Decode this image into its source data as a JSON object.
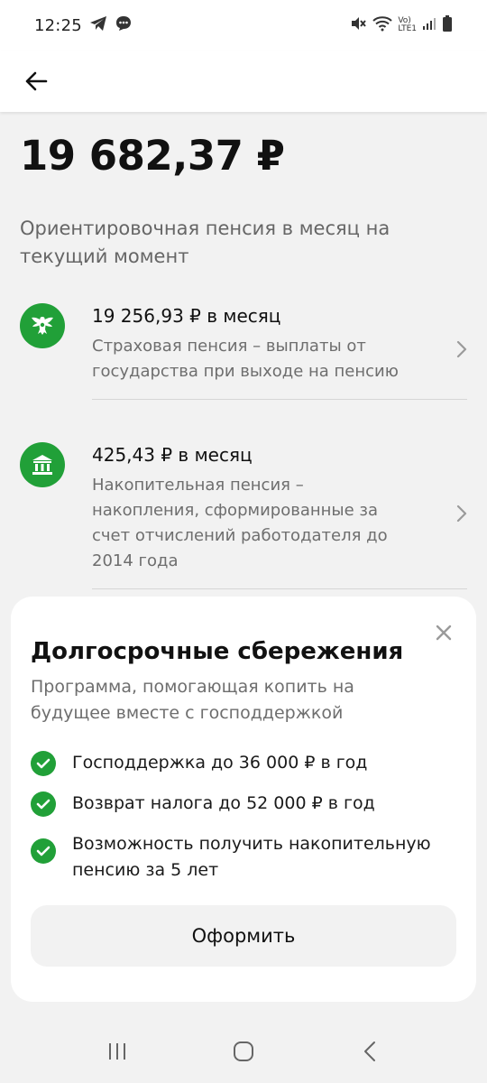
{
  "status_bar": {
    "time": "12:25",
    "network_label_top": "Vo)",
    "network_label_bottom": "LTE1"
  },
  "header": {
    "back_icon": "arrow-left-icon"
  },
  "summary": {
    "amount": "19 682,37 ₽",
    "subtitle": "Ориентировочная пенсия в месяц на текущий момент"
  },
  "pensions": [
    {
      "icon": "eagle-emblem-icon",
      "title": "19 256,93 ₽ в месяц",
      "description": "Страховая пенсия – выплаты от государства при выходе на пенсию"
    },
    {
      "icon": "bank-building-icon",
      "title": "425,43 ₽ в месяц",
      "description": "Накопительная пенсия – накопления, сформированные за счет отчислений работодателя до 2014 года"
    }
  ],
  "promo_sheet": {
    "title": "Долгосрочные сбережения",
    "subtitle": "Программа, помогающая копить на будущее вместе с господдержкой",
    "benefits": [
      "Господдержка до 36 000 ₽ в год",
      "Возврат налога до 52 000 ₽ в год",
      "Возможность получить накопительную пенсию за 5 лет"
    ],
    "button_label": "Оформить"
  },
  "colors": {
    "accent": "#21a038",
    "background": "#f2f2f2",
    "surface": "#ffffff",
    "secondary_text": "#6e6e6e"
  }
}
